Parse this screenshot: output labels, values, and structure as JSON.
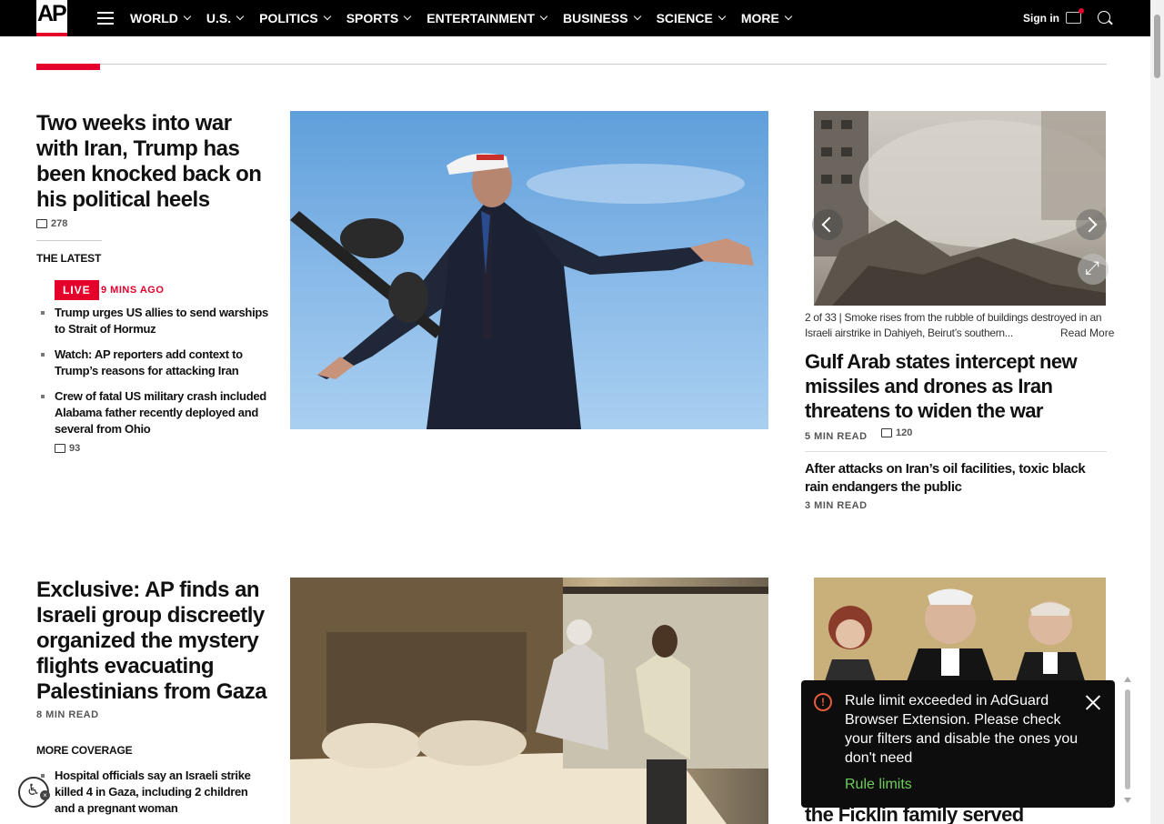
{
  "nav": {
    "logo": "AP",
    "items": [
      "WORLD",
      "U.S.",
      "POLITICS",
      "SPORTS",
      "ENTERTAINMENT",
      "BUSINESS",
      "SCIENCE",
      "MORE"
    ],
    "signin": "Sign in"
  },
  "lead": {
    "title": "Two weeks into war with Iran, Trump has been knocked back on his political heels",
    "comments": "278",
    "latest_label": "THE LATEST",
    "live": "LIVE",
    "live_time": "9 MINS AGO",
    "bullets": [
      "Trump urges US allies to send warships to Strait of Hormuz",
      "Watch: AP reporters add context to Trump’s reasons for attacking Iran",
      "Crew of fatal US military crash included Alabama father recently deployed and several from Ohio"
    ],
    "bullet3_comments": "93"
  },
  "slideshow": {
    "count": "2 of 33 |",
    "caption": "Smoke rises from the rubble of buildings destroyed in an Israeli airstrike in Dahiyeh, Beirut’s southern...",
    "read_more": "Read More"
  },
  "story2": {
    "title": "Gulf Arab states intercept new missiles and drones as Iran threatens to widen the war",
    "read_time": "5 MIN READ",
    "comments": "120"
  },
  "story3": {
    "title": "After attacks on Iran’s oil facilities, toxic black rain endangers the public",
    "read_time": "3 MIN READ"
  },
  "story4": {
    "title": "Exclusive: AP finds an Israeli group discreetly organized the mystery flights evacuating Palestinians from Gaza",
    "read_time": "8 MIN READ",
    "more_coverage": "MORE COVERAGE",
    "bullet": "Hospital officials say an Israeli strike killed 4 in Gaza, including 2 children and a pregnant woman"
  },
  "story5": {
    "title_partial": "the Ficklin family served"
  },
  "toast": {
    "message": "Rule limit exceeded in AdGuard Browser Extension. Please check your filters and disable the ones you don't need",
    "link": "Rule limits",
    "icon": "!"
  },
  "colors": {
    "accent": "#e4002b",
    "toast_link": "#6fce5b"
  }
}
